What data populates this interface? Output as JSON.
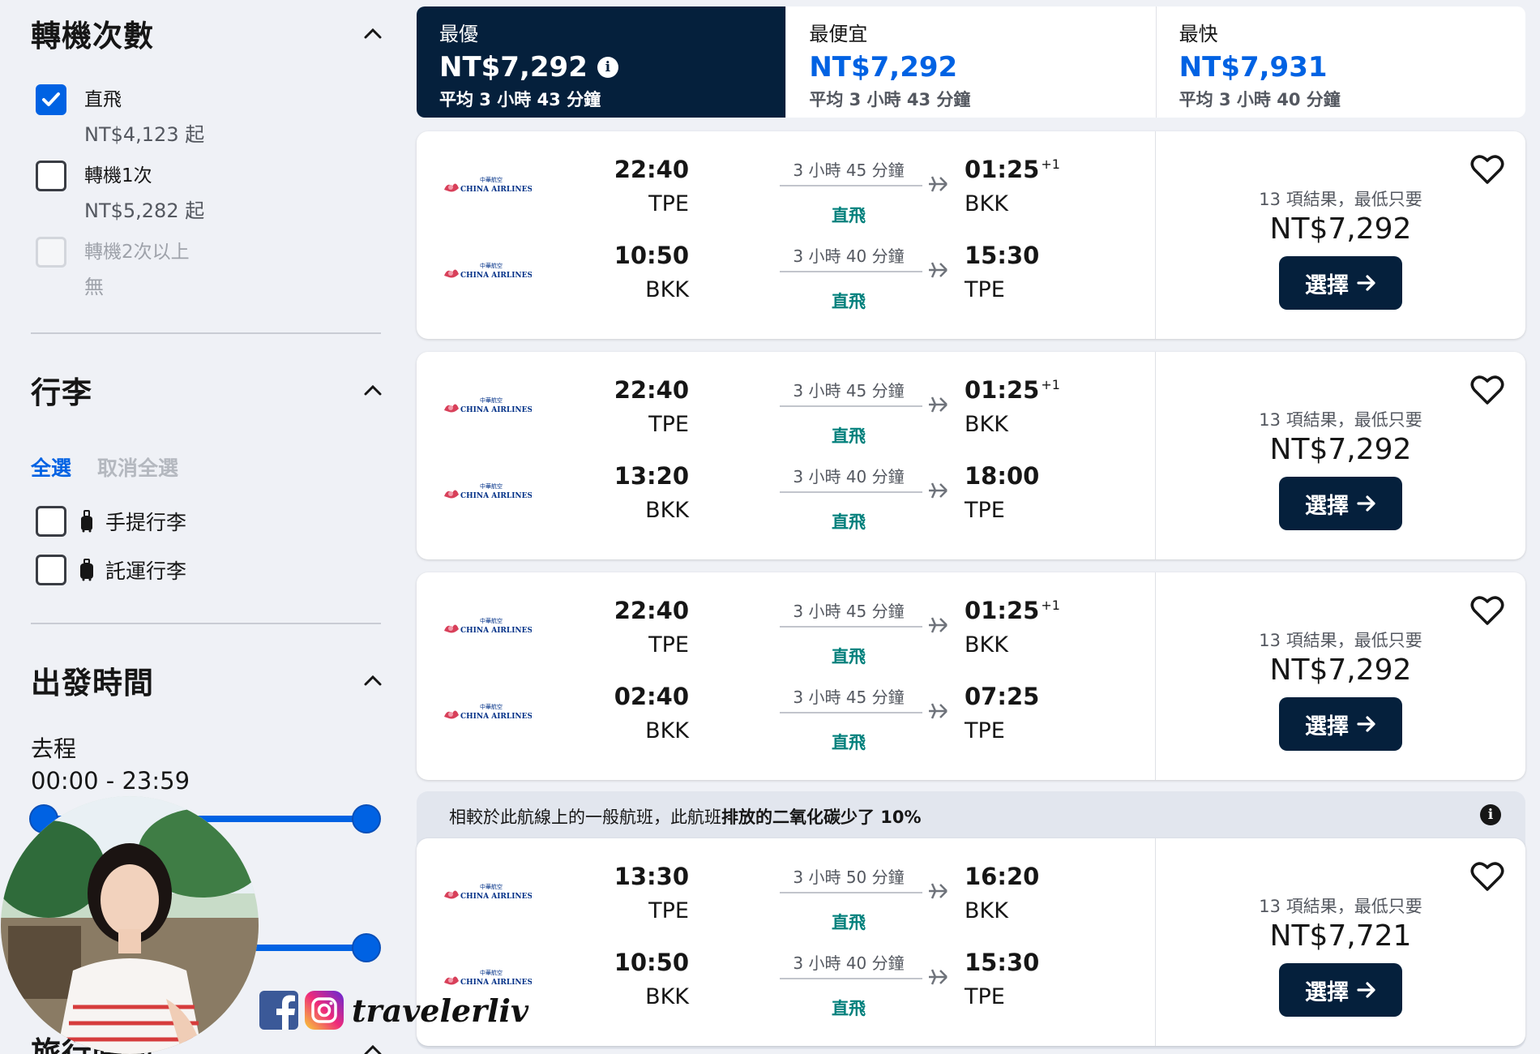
{
  "sidebar": {
    "stops": {
      "title": "轉機次數",
      "options": [
        {
          "label": "直飛",
          "price": "NT$4,123 起",
          "checked": true
        },
        {
          "label": "轉機1次",
          "price": "NT$5,282 起",
          "checked": false
        },
        {
          "label": "轉機2次以上",
          "price": "無",
          "checked": false
        }
      ]
    },
    "baggage": {
      "title": "行李",
      "select_all": "全選",
      "deselect_all": "取消全選",
      "options": [
        {
          "label": "手提行李"
        },
        {
          "label": "託運行李"
        }
      ]
    },
    "departure": {
      "title": "出發時間",
      "outbound_label": "去程",
      "outbound_range": "00:00 - 23:59"
    },
    "next_section_title": "旅行時間"
  },
  "summary": [
    {
      "name": "最優",
      "price": "NT$7,292",
      "duration": "平均 3 小時 43 分鐘"
    },
    {
      "name": "最便宜",
      "price": "NT$7,292",
      "duration": "平均 3 小時 43 分鐘"
    },
    {
      "name": "最快",
      "price": "NT$7,931",
      "duration": "平均 3 小時 40 分鐘"
    }
  ],
  "results": [
    {
      "legs": [
        {
          "airline": "CHINA AIRLINES",
          "dep_time": "22:40",
          "dep_code": "TPE",
          "duration": "3 小時 45 分鐘",
          "stops": "直飛",
          "arr_time": "01:25",
          "arr_offset": "+1",
          "arr_code": "BKK"
        },
        {
          "airline": "CHINA AIRLINES",
          "dep_time": "10:50",
          "dep_code": "BKK",
          "duration": "3 小時 40 分鐘",
          "stops": "直飛",
          "arr_time": "15:30",
          "arr_offset": "",
          "arr_code": "TPE"
        }
      ],
      "count": "13 項結果，最低只要",
      "price": "NT$7,292",
      "button": "選擇"
    },
    {
      "legs": [
        {
          "airline": "CHINA AIRLINES",
          "dep_time": "22:40",
          "dep_code": "TPE",
          "duration": "3 小時 45 分鐘",
          "stops": "直飛",
          "arr_time": "01:25",
          "arr_offset": "+1",
          "arr_code": "BKK"
        },
        {
          "airline": "CHINA AIRLINES",
          "dep_time": "13:20",
          "dep_code": "BKK",
          "duration": "3 小時 40 分鐘",
          "stops": "直飛",
          "arr_time": "18:00",
          "arr_offset": "",
          "arr_code": "TPE"
        }
      ],
      "count": "13 項結果，最低只要",
      "price": "NT$7,292",
      "button": "選擇"
    },
    {
      "legs": [
        {
          "airline": "CHINA AIRLINES",
          "dep_time": "22:40",
          "dep_code": "TPE",
          "duration": "3 小時 45 分鐘",
          "stops": "直飛",
          "arr_time": "01:25",
          "arr_offset": "+1",
          "arr_code": "BKK"
        },
        {
          "airline": "CHINA AIRLINES",
          "dep_time": "02:40",
          "dep_code": "BKK",
          "duration": "3 小時 45 分鐘",
          "stops": "直飛",
          "arr_time": "07:25",
          "arr_offset": "",
          "arr_code": "TPE"
        }
      ],
      "count": "13 項結果，最低只要",
      "price": "NT$7,292",
      "button": "選擇"
    },
    {
      "legs": [
        {
          "airline": "CHINA AIRLINES",
          "dep_time": "13:30",
          "dep_code": "TPE",
          "duration": "3 小時 50 分鐘",
          "stops": "直飛",
          "arr_time": "16:20",
          "arr_offset": "",
          "arr_code": "BKK"
        },
        {
          "airline": "CHINA AIRLINES",
          "dep_time": "10:50",
          "dep_code": "BKK",
          "duration": "3 小時 40 分鐘",
          "stops": "直飛",
          "arr_time": "15:30",
          "arr_offset": "",
          "arr_code": "TPE"
        }
      ],
      "count": "13 項結果，最低只要",
      "price": "NT$7,721",
      "button": "選擇"
    }
  ],
  "eco_banner": {
    "prefix": "相較於此航線上的一般航班，此航班",
    "bold": "排放的二氧化碳少了 10%"
  },
  "watermark": {
    "handle": "travelerliv"
  },
  "colors": {
    "accent": "#0062e3",
    "navy": "#05203c",
    "teal": "#00807c"
  }
}
